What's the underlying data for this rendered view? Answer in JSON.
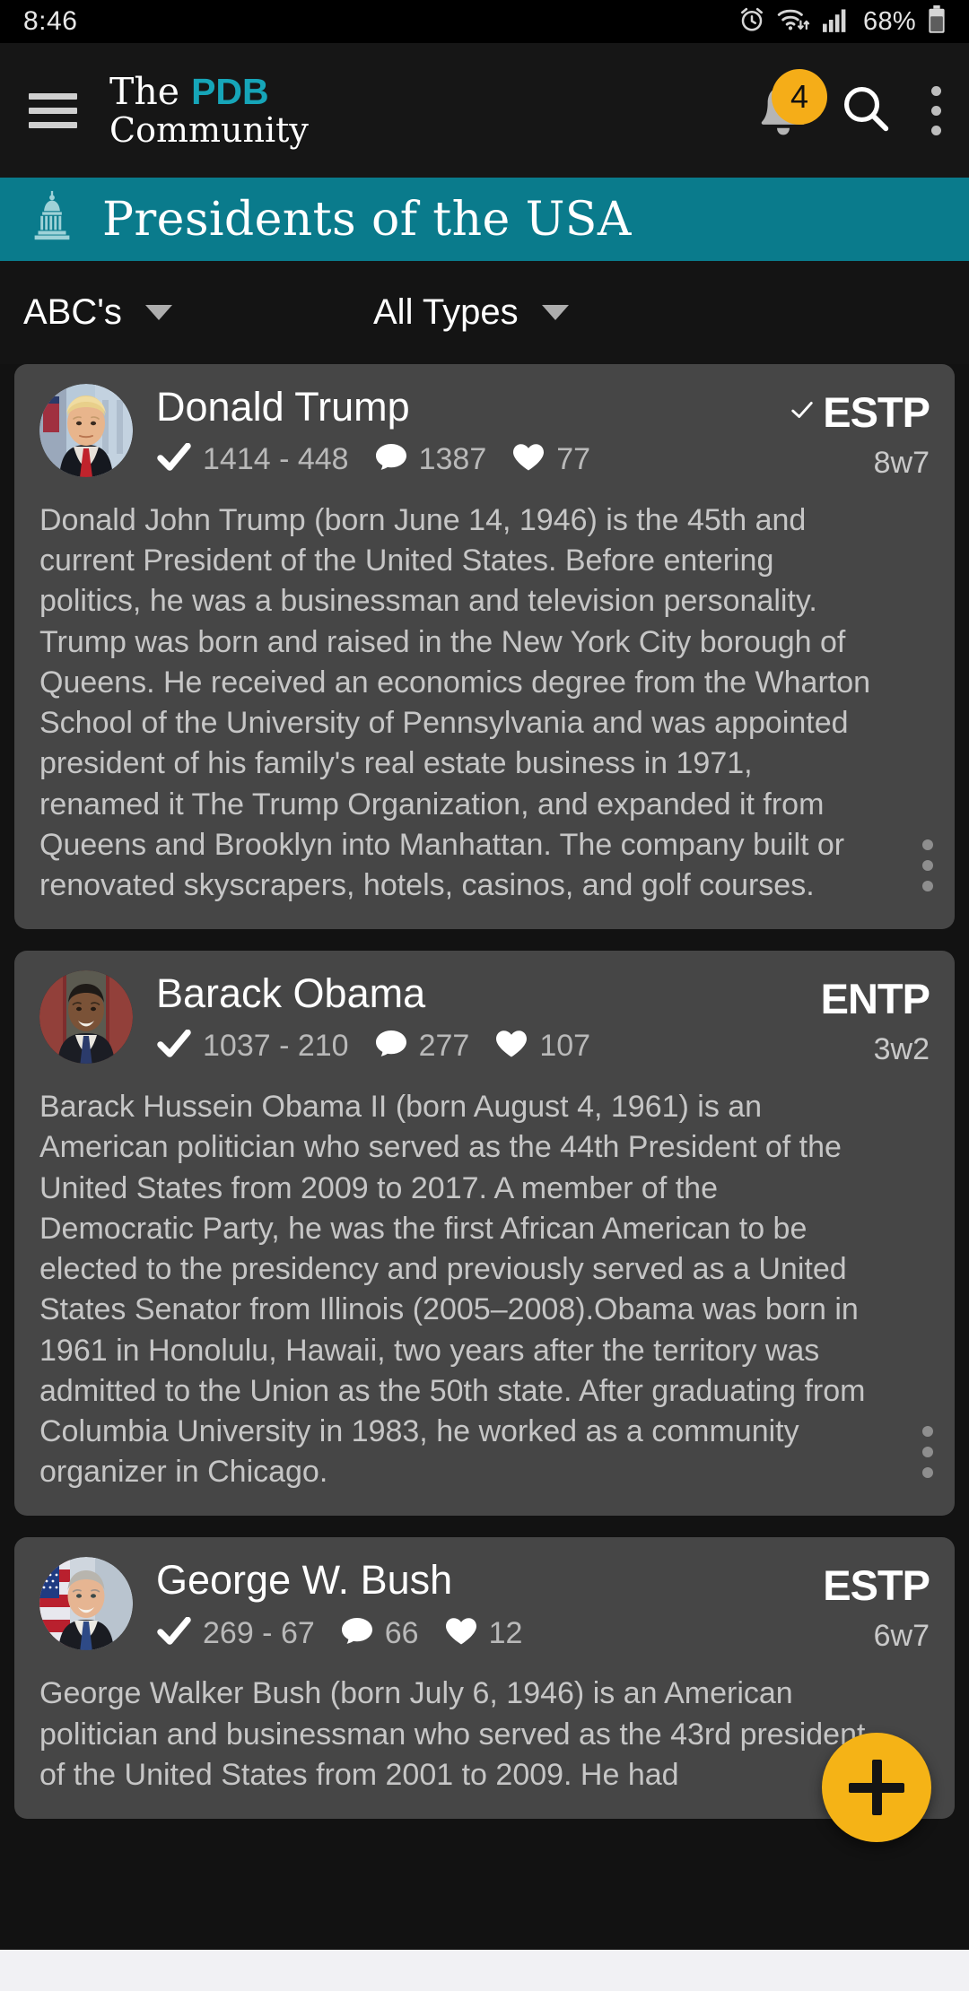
{
  "status_bar": {
    "time": "8:46",
    "battery_percent": "68%",
    "icons": [
      "alarm-icon",
      "wifi-icon",
      "cellular-signal-icon",
      "battery-icon"
    ]
  },
  "app_bar": {
    "menu_icon": "hamburger-menu-icon",
    "brand_line1_prefix": "The ",
    "brand_line1_accent": "PDB",
    "brand_line2": "Community",
    "brand_accent_color": "#16a5b8",
    "notification_count": "4",
    "notification_badge_color": "#f5ad18",
    "search_icon": "search-icon",
    "overflow_icon": "kebab-menu-icon"
  },
  "banner": {
    "icon": "capitol-building-icon",
    "title": "Presidents of the USA",
    "background_color": "#0a7b8c"
  },
  "filters": [
    {
      "label": "ABC's",
      "name": "sort-filter"
    },
    {
      "label": "All Types",
      "name": "type-filter"
    }
  ],
  "feed": {
    "cards": [
      {
        "name": "Donald Trump",
        "avatar": "donald-trump-avatar",
        "vote_icon": "checkmark-icon",
        "votes": "1414 - 448",
        "comment_icon": "comment-icon",
        "comments": "1387",
        "like_icon": "heart-icon",
        "likes": "77",
        "voted": true,
        "mbti": "ESTP",
        "enneagram": "8w7",
        "bio": "Donald John Trump (born June 14, 1946) is the 45th and current President of the United States. Before entering politics, he was a businessman and television personality. Trump was born and raised in the New York City borough of Queens. He received an economics degree from the Wharton School of the University of Pennsylvania and was appointed president of his family's real estate business in 1971, renamed it The Trump Organization, and expanded it from Queens and Brooklyn into Manhattan. The company built or renovated skyscrapers, hotels, casinos, and golf courses."
      },
      {
        "name": "Barack Obama",
        "avatar": "barack-obama-avatar",
        "vote_icon": "checkmark-icon",
        "votes": "1037 - 210",
        "comment_icon": "comment-icon",
        "comments": "277",
        "like_icon": "heart-icon",
        "likes": "107",
        "voted": false,
        "mbti": "ENTP",
        "enneagram": "3w2",
        "bio": "Barack Hussein Obama II (born August 4, 1961) is an American politician who served as the 44th President of the United States from 2009 to 2017. A member of the Democratic Party, he was the first African American to be elected to the presidency and previously served as a United States Senator from Illinois (2005–2008).Obama was born in 1961 in Honolulu, Hawaii, two years after the territory was admitted to the Union as the 50th state. After graduating from Columbia University in 1983, he worked as a community organizer in Chicago."
      },
      {
        "name": "George W. Bush",
        "avatar": "george-w-bush-avatar",
        "vote_icon": "checkmark-icon",
        "votes": "269 - 67",
        "comment_icon": "comment-icon",
        "comments": "66",
        "like_icon": "heart-icon",
        "likes": "12",
        "voted": false,
        "mbti": "ESTP",
        "enneagram": "6w7",
        "bio": "George Walker Bush (born July 6, 1946) is an American politician and businessman who served as the 43rd president of the United States from 2001 to 2009. He had"
      }
    ]
  },
  "fab": {
    "icon": "plus-icon",
    "color": "#f5b316"
  },
  "nav_bar": {
    "pills": 3
  }
}
